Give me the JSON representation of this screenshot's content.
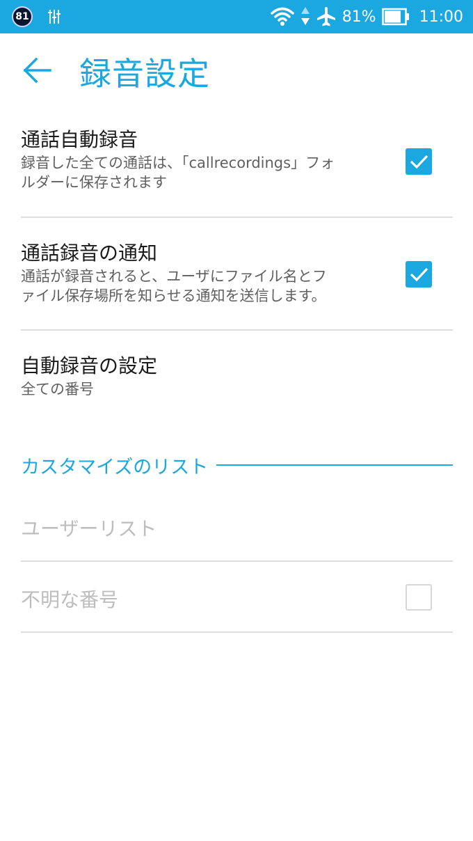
{
  "status_bar": {
    "badge": "81",
    "battery_percent": "81%",
    "time": "11:00",
    "icons": [
      "usb-debug-icon",
      "wifi-icon",
      "data-arrows-icon",
      "airplane-icon",
      "battery-icon"
    ]
  },
  "header": {
    "title": "録音設定",
    "back_icon": "arrow-left-icon"
  },
  "settings": [
    {
      "title": "通話自動録音",
      "subtitle_line1": "録音した全ての通話は、「callrecordings」フォ",
      "subtitle_line2": "ルダーに保存されます",
      "checked": true
    },
    {
      "title": "通話録音の通知",
      "subtitle_line1": "通話が録音されると、ユーザにファイル名とフ",
      "subtitle_line2": "ァイル保存場所を知らせる通知を送信します。",
      "checked": true
    },
    {
      "title": "自動録音の設定",
      "subtitle": "全ての番号"
    }
  ],
  "custom_list": {
    "header": "カスタマイズのリスト",
    "user_list": "ユーザーリスト",
    "unknown_numbers": "不明な番号",
    "unknown_checked": false
  },
  "colors": {
    "accent": "#1ba7df",
    "status_bar": "#1ba7df",
    "divider": "#dedede",
    "disabled_text": "#bdbdbd"
  }
}
